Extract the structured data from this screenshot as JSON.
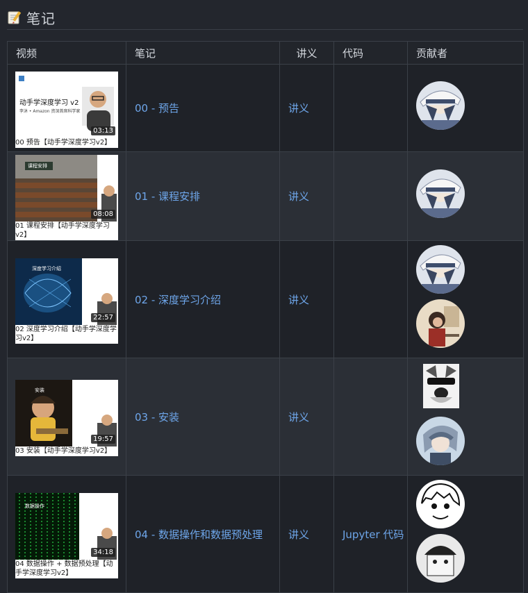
{
  "page": {
    "title": "笔记",
    "icon": "memo-icon"
  },
  "table": {
    "headers": {
      "video": "视频",
      "note": "笔记",
      "lecture": "讲义",
      "code": "代码",
      "contributors": "贡献者"
    },
    "rows": [
      {
        "video_caption": "00 预告【动手学深度学习v2】",
        "duration": "03:13",
        "thumb_text": "动手学深度学习 v2",
        "thumb_sub": "李沐 • Amazon 资深首席科学家",
        "note": "00 - 预告",
        "lecture": "讲义",
        "code": ""
      },
      {
        "video_caption": "01 课程安排【动手学深度学习v2】",
        "duration": "08:08",
        "thumb_text": "课程安排",
        "note": "01 - 课程安排",
        "lecture": "讲义",
        "code": ""
      },
      {
        "video_caption": "02 深度学习介绍【动手学深度学习v2】",
        "duration": "22:57",
        "thumb_text": "深度学习介绍",
        "note": "02 - 深度学习介绍",
        "lecture": "讲义",
        "code": ""
      },
      {
        "video_caption": "03 安装【动手学深度学习v2】",
        "duration": "19:57",
        "thumb_text": "安装",
        "note": "03 - 安装",
        "lecture": "讲义",
        "code": ""
      },
      {
        "video_caption": "04 数据操作 + 数据预处理【动手学深度学习v2】",
        "duration": "34:18",
        "thumb_text": "数据操作",
        "note": "04 - 数据操作和数据预处理",
        "lecture": "讲义",
        "code": "Jupyter 代码"
      }
    ]
  },
  "colors": {
    "background": "#23262d",
    "link": "#6ea6ea",
    "border": "#3b4048"
  }
}
